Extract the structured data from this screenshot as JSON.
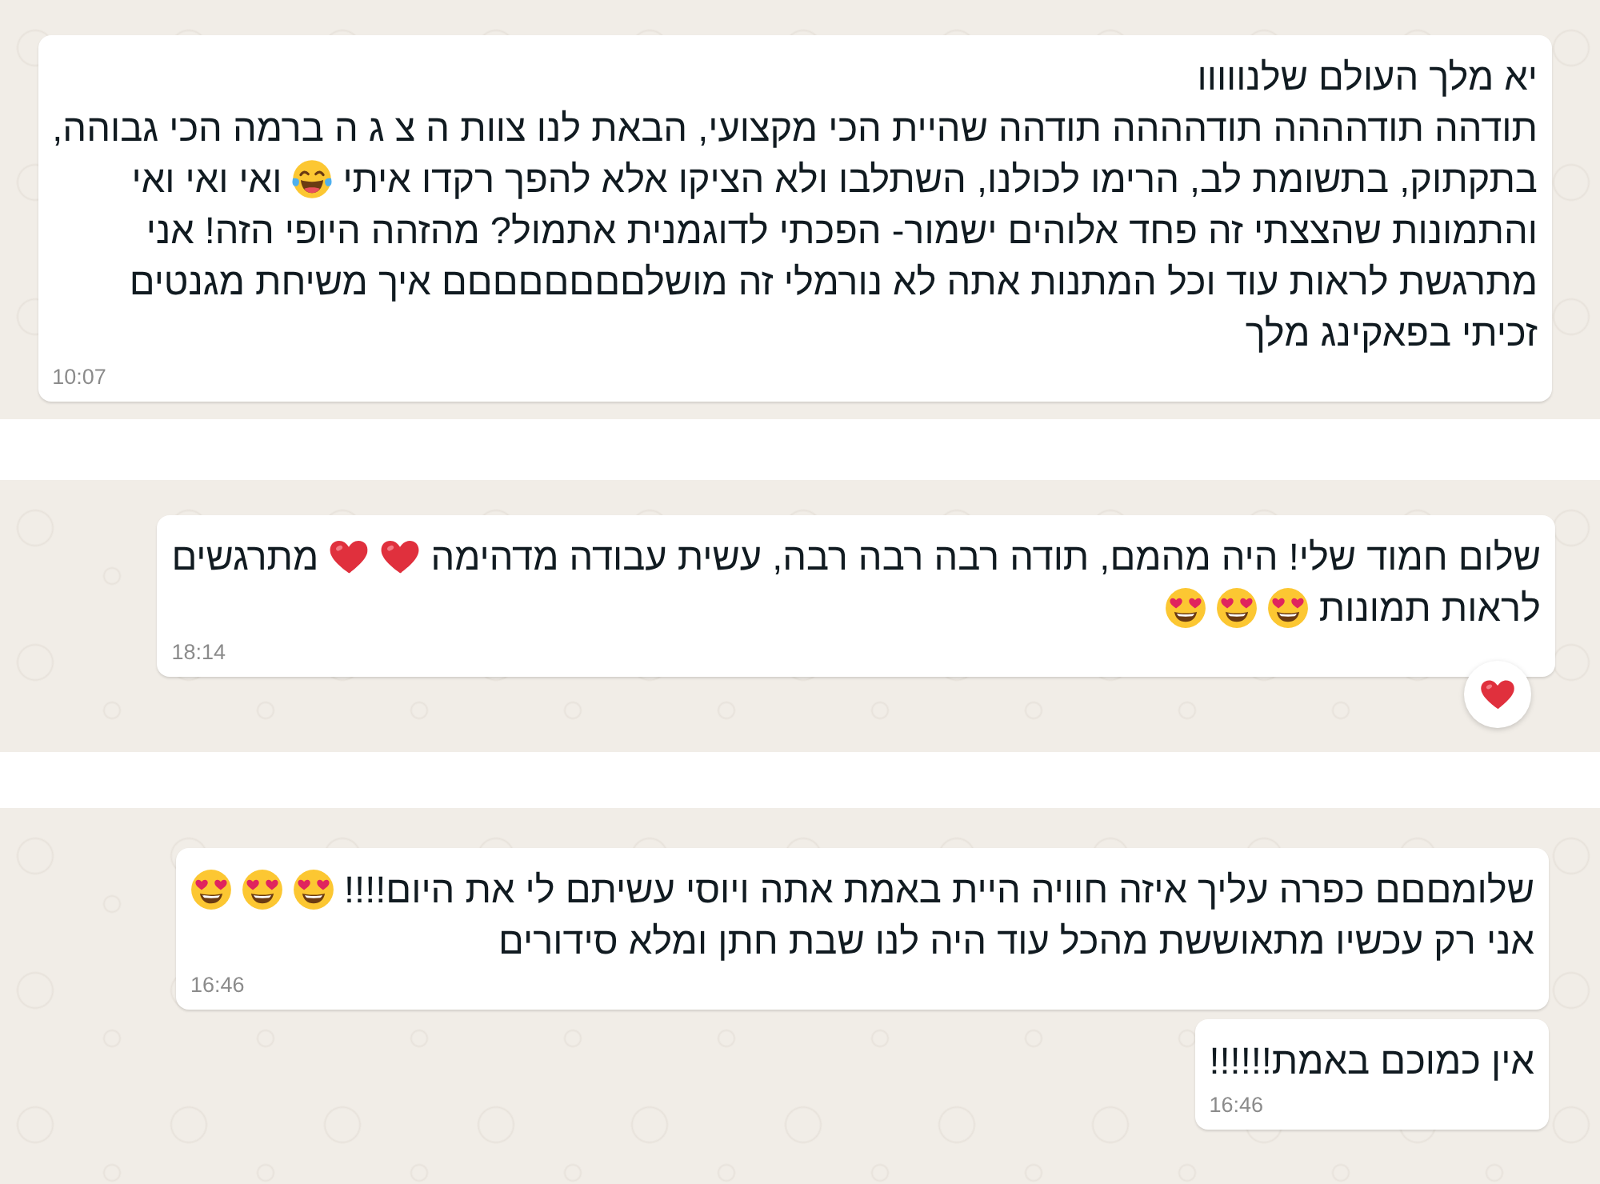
{
  "screenshots": [
    {
      "messages": [
        {
          "lines": [
            [
              {
                "kind": "text",
                "text": "יא מלך העולם שלנווווו"
              }
            ],
            [
              {
                "kind": "text",
                "text": "תודהה תודהההה תודהההה תודהה שהיית הכי מקצועי, הבאת לנו צוות ה צ ג ה ברמה הכי גבוהה,"
              }
            ],
            [
              {
                "kind": "text",
                "text": "בתקתוק, בתשומת לב, הרימו לכולנו, השתלבו ולא הציקו אלא להפך רקדו איתי"
              },
              {
                "kind": "tears_of_joy"
              },
              {
                "kind": "text",
                "text": "ואי ואי ואי"
              }
            ],
            [
              {
                "kind": "text",
                "text": "והתמונות שהצצתי זה פחד אלוהים ישמור- הפכתי לדוגמנית אתמול? מהזהה היופי הזה! אני"
              }
            ],
            [
              {
                "kind": "text",
                "text": "מתרגשת לראות עוד וכל המתנות אתה לא נורמלי זה מושלםםםםםםםם איך משיחת מגנטים"
              }
            ],
            [
              {
                "kind": "text",
                "text": "זכיתי בפאקינג מלך"
              }
            ]
          ],
          "time": "10:07"
        }
      ]
    },
    {
      "messages": [
        {
          "lines": [
            [
              {
                "kind": "text",
                "text": "שלום חמוד שלי! היה מהמם, תודה רבה רבה רבה, עשית עבודה מדהימה"
              },
              {
                "kind": "heart"
              },
              {
                "kind": "heart"
              },
              {
                "kind": "text",
                "text": "מתרגשים"
              }
            ],
            [
              {
                "kind": "text",
                "text": "לראות תמונות"
              },
              {
                "kind": "heart_eyes"
              },
              {
                "kind": "heart_eyes"
              },
              {
                "kind": "heart_eyes"
              }
            ]
          ],
          "time": "18:14",
          "reactions": [
            {
              "kind": "heart"
            }
          ]
        }
      ]
    },
    {
      "messages": [
        {
          "lines": [
            [
              {
                "kind": "text",
                "text": "שלומםםם כפרה עליך איזה חוויה היית באמת אתה ויוסי עשיתם לי את היום!!!!"
              },
              {
                "kind": "heart_eyes"
              },
              {
                "kind": "heart_eyes"
              },
              {
                "kind": "heart_eyes"
              }
            ],
            [
              {
                "kind": "text",
                "text": "אני רק עכשיו מתאוששת מהכל עוד היה לנו שבת חתן ומלא סידורים"
              }
            ]
          ],
          "time": "16:46"
        },
        {
          "lines": [
            [
              {
                "kind": "text",
                "text": "אין כמוכם באמת!!!!!!"
              }
            ]
          ],
          "time": "16:46"
        }
      ]
    }
  ]
}
